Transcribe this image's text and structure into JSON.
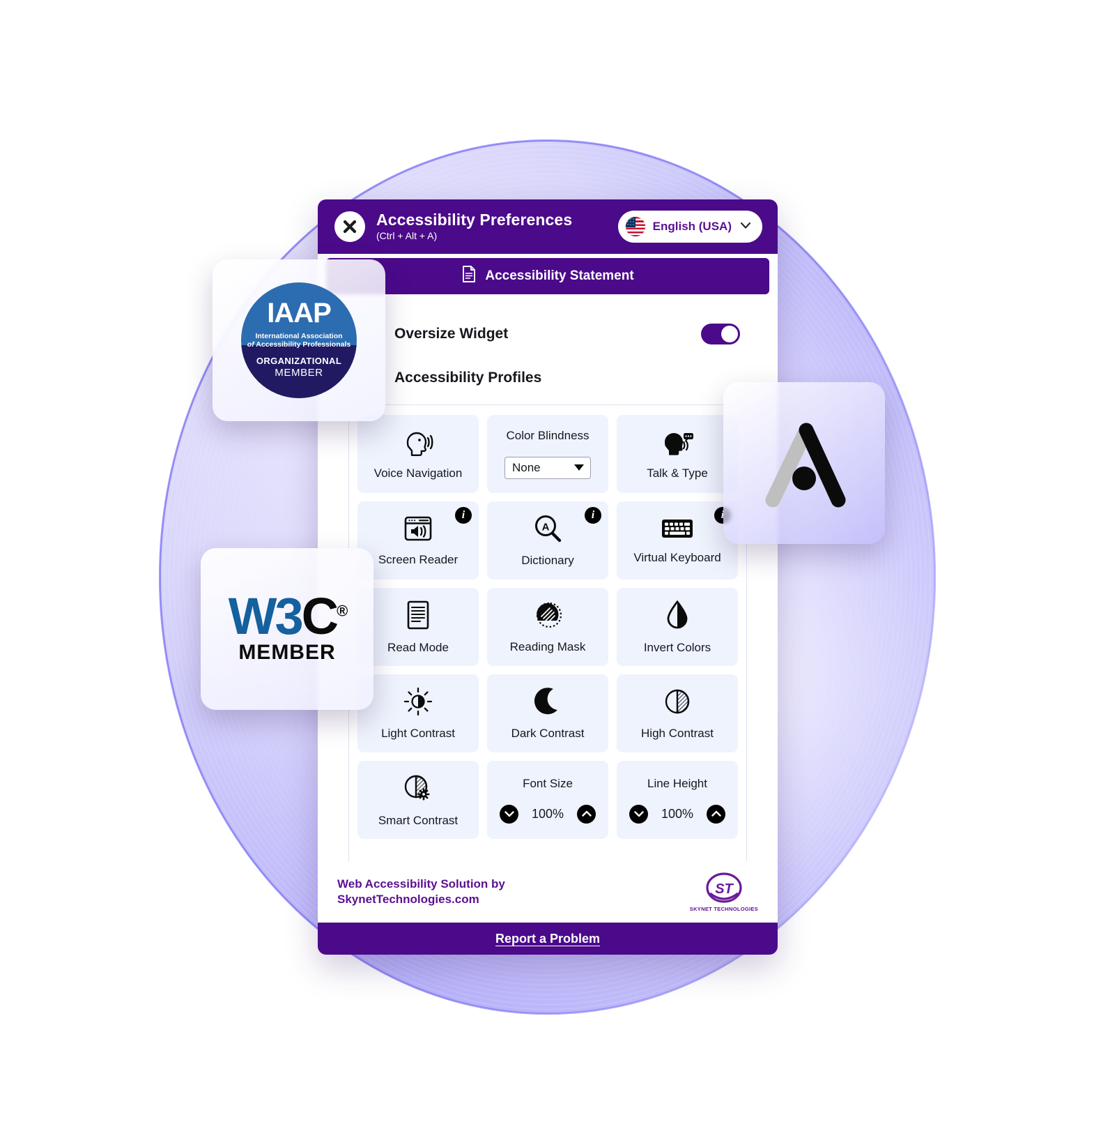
{
  "header": {
    "close_icon": "close-x-icon",
    "title": "Accessibility Preferences",
    "shortcut": "(Ctrl + Alt + A)",
    "language": "English (USA)",
    "language_flag_icon": "usa-flag-icon",
    "chevron_icon": "chevron-down-icon",
    "bg_color": "#4B0A8A"
  },
  "statement": {
    "label": "Accessibility Statement",
    "icon": "document-icon"
  },
  "settings": {
    "oversize_widget_label": "Oversize Widget",
    "oversize_widget_on": true,
    "profiles_label": "Accessibility Profiles"
  },
  "grid": {
    "rows": [
      [
        {
          "type": "icon",
          "label": "Voice Navigation",
          "icon": "head-speaking-icon",
          "info": false
        },
        {
          "type": "select",
          "label": "Color Blindness",
          "value": "None",
          "icon": "dropdown-icon",
          "info": false
        },
        {
          "type": "icon",
          "label": "Talk & Type",
          "icon": "head-talk-bubble-icon",
          "info": false
        }
      ],
      [
        {
          "type": "icon",
          "label": "Screen Reader",
          "icon": "screen-reader-icon",
          "info": true
        },
        {
          "type": "icon",
          "label": "Dictionary",
          "icon": "magnifier-a-icon",
          "info": true
        },
        {
          "type": "icon",
          "label": "Virtual Keyboard",
          "icon": "keyboard-icon",
          "info": true
        }
      ],
      [
        {
          "type": "icon",
          "label": "Read Mode",
          "icon": "document-lines-icon",
          "info": false
        },
        {
          "type": "icon",
          "label": "Reading Mask",
          "icon": "reading-mask-icon",
          "info": false
        },
        {
          "type": "icon",
          "label": "Invert Colors",
          "icon": "droplet-half-icon",
          "info": false
        }
      ],
      [
        {
          "type": "icon",
          "label": "Light Contrast",
          "icon": "sun-half-icon",
          "info": false
        },
        {
          "type": "icon",
          "label": "Dark Contrast",
          "icon": "moon-icon",
          "info": false
        },
        {
          "type": "icon",
          "label": "High Contrast",
          "icon": "circle-half-hatch-icon",
          "info": false
        }
      ],
      [
        {
          "type": "icon",
          "label": "Smart Contrast",
          "icon": "circle-hatch-gear-icon",
          "info": false
        },
        {
          "type": "stepper",
          "label": "Font Size",
          "value": "100%",
          "dec_icon": "chevron-down-icon",
          "inc_icon": "chevron-up-icon",
          "info": false
        },
        {
          "type": "stepper",
          "label": "Line Height",
          "value": "100%",
          "dec_icon": "chevron-down-icon",
          "inc_icon": "chevron-up-icon",
          "info": false
        }
      ]
    ]
  },
  "footer": {
    "line1": "Web Accessibility Solution by",
    "line2": "SkynetTechnologies.com",
    "brand_mark": "ST",
    "brand_name": "SKYNET TECHNOLOGIES",
    "report_label": "Report a Problem"
  },
  "badges": {
    "iaap": {
      "acronym": "IAAP",
      "line1": "International Association",
      "line2_italic": "of",
      "line2": "Accessibility Professionals",
      "tier": "ORGANIZATIONAL",
      "member": "MEMBER"
    },
    "w3c": {
      "mark_blue": "W3",
      "mark_black": "C",
      "registered": "®",
      "member": "MEMBER"
    },
    "a11y_logo": "accessibility-a-logo"
  },
  "colors": {
    "purple": "#4B0A8A",
    "purple_text": "#5B1091",
    "tile_bg": "#EEF3FD",
    "iaap_blue": "#2C6CB0",
    "iaap_navy": "#211A62",
    "w3c_blue": "#15609E"
  }
}
